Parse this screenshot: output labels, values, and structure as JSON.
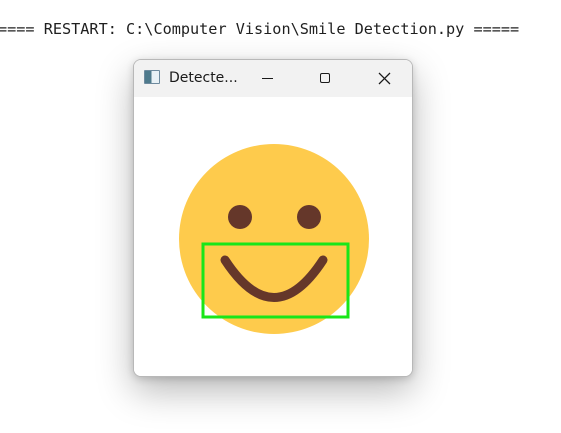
{
  "console": {
    "restart_line": "==== RESTART: C:\\Computer Vision\\Smile Detection.py ====="
  },
  "window": {
    "title": "Detecte...",
    "controls": {
      "minimize": "minimize-icon",
      "maximize": "maximize-icon",
      "close": "close-icon"
    }
  },
  "image": {
    "face_color": "#fecb4c",
    "feature_color": "#65372a",
    "detection_box_color": "#19e619"
  }
}
